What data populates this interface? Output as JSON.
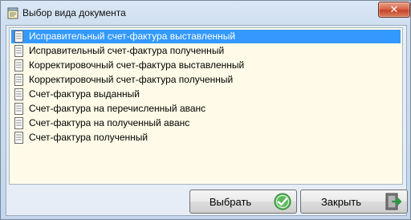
{
  "window": {
    "title": "Выбор вида документа",
    "close_label": "✕"
  },
  "list": {
    "items": [
      {
        "label": "Исправительный счет-фактура выставленный",
        "selected": true
      },
      {
        "label": "Исправительный счет-фактура полученный",
        "selected": false
      },
      {
        "label": "Корректировочный счет-фактура выставленный",
        "selected": false
      },
      {
        "label": "Корректировочный счет-фактура полученный",
        "selected": false
      },
      {
        "label": "Счет-фактура выданный",
        "selected": false
      },
      {
        "label": "Счет-фактура на перечисленный аванс",
        "selected": false
      },
      {
        "label": "Счет-фактура на полученный аванс",
        "selected": false
      },
      {
        "label": "Счет-фактура полученный",
        "selected": false
      }
    ]
  },
  "buttons": {
    "select_label": "Выбрать",
    "close_label": "Закрыть"
  },
  "colors": {
    "selection": "#3399ff",
    "list_background": "#fffbe8"
  },
  "icons": {
    "title": "notepad-icon",
    "item": "document-icon",
    "select": "green-check-icon",
    "close": "exit-door-icon"
  }
}
